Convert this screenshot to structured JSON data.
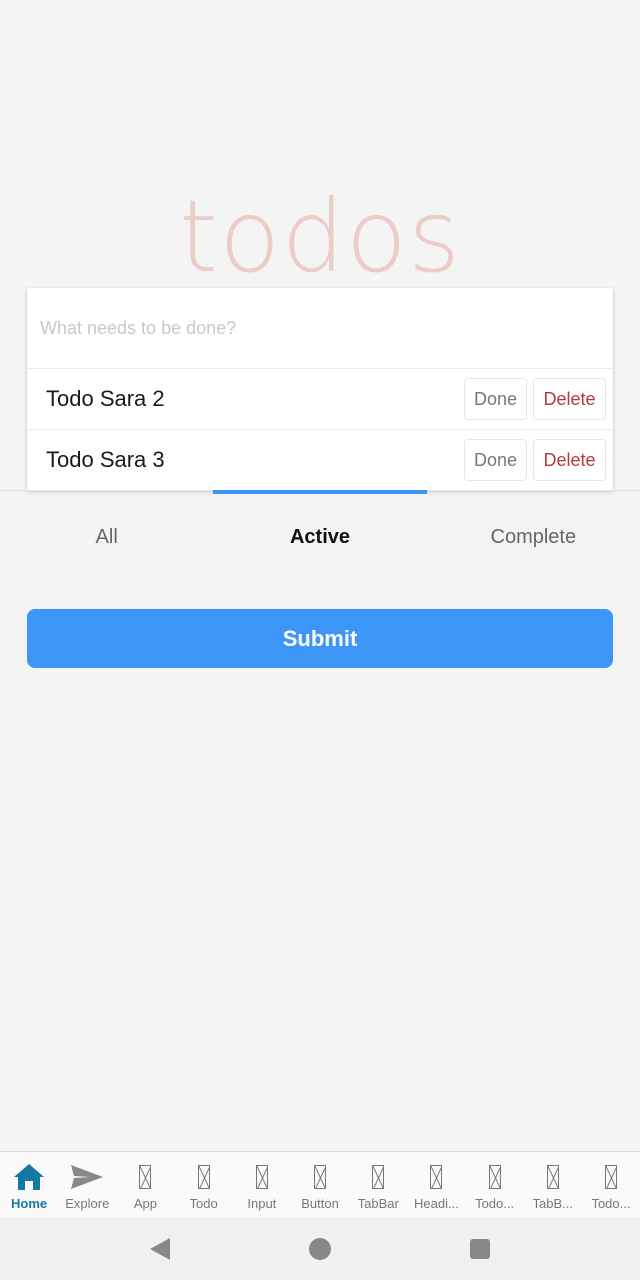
{
  "app": {
    "title": "todos"
  },
  "new_todo": {
    "placeholder": "What needs to be done?",
    "value": ""
  },
  "todos": [
    {
      "text": "Todo Sara 2",
      "done_label": "Done",
      "delete_label": "Delete"
    },
    {
      "text": "Todo Sara 3",
      "done_label": "Done",
      "delete_label": "Delete"
    }
  ],
  "filter_tabs": [
    {
      "label": "All",
      "active": false
    },
    {
      "label": "Active",
      "active": true
    },
    {
      "label": "Complete",
      "active": false
    }
  ],
  "submit": {
    "label": "Submit"
  },
  "bottom_nav": [
    {
      "label": "Home",
      "icon": "home-icon",
      "active": true
    },
    {
      "label": "Explore",
      "icon": "send-icon",
      "active": false
    },
    {
      "label": "App",
      "icon": "missing-glyph-icon",
      "active": false
    },
    {
      "label": "Todo",
      "icon": "missing-glyph-icon",
      "active": false
    },
    {
      "label": "Input",
      "icon": "missing-glyph-icon",
      "active": false
    },
    {
      "label": "Button",
      "icon": "missing-glyph-icon",
      "active": false
    },
    {
      "label": "TabBar",
      "icon": "missing-glyph-icon",
      "active": false
    },
    {
      "label": "Headi...",
      "icon": "missing-glyph-icon",
      "active": false
    },
    {
      "label": "Todo...",
      "icon": "missing-glyph-icon",
      "active": false
    },
    {
      "label": "TabB...",
      "icon": "missing-glyph-icon",
      "active": false
    },
    {
      "label": "Todo...",
      "icon": "missing-glyph-icon",
      "active": false
    }
  ],
  "colors": {
    "accent": "#3d95f8",
    "title": "#eacdc6",
    "delete": "#b23a3a",
    "nav_active": "#1478a5",
    "background": "#f4f4f4"
  }
}
